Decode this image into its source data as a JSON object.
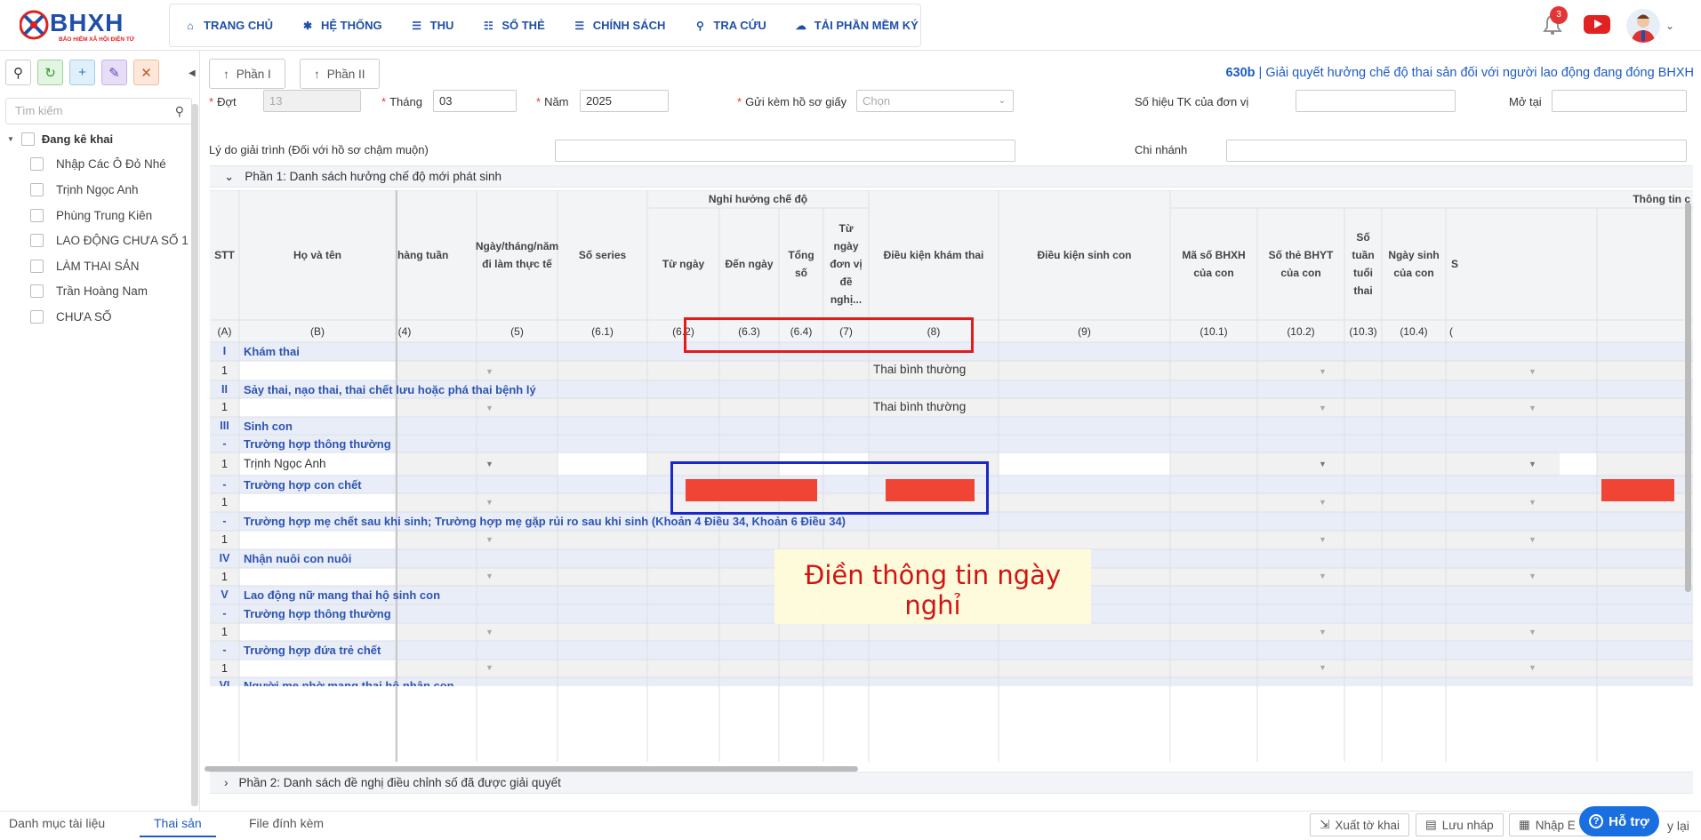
{
  "brand": {
    "name": "BHXH",
    "tagline": "BẢO HIỂM XÃ HỘI ĐIỆN TỬ"
  },
  "nav": [
    {
      "label": "TRANG CHỦ",
      "icon": "home-icon"
    },
    {
      "label": "HỆ THỐNG",
      "icon": "gear-icon"
    },
    {
      "label": "THU",
      "icon": "document-icon"
    },
    {
      "label": "SỔ THẺ",
      "icon": "card-icon"
    },
    {
      "label": "CHÍNH SÁCH",
      "icon": "policy-icon"
    },
    {
      "label": "TRA CỨU",
      "icon": "search-icon"
    },
    {
      "label": "TẢI PHẦN MỀM KÝ",
      "icon": "cloud-download-icon"
    }
  ],
  "header": {
    "notification_count": "3"
  },
  "sidebar": {
    "search_placeholder": "Tìm kiếm",
    "root_label": "Đang kê khai",
    "items": [
      "Nhập Các Ô Đỏ Nhé",
      "Trịnh Ngọc Anh",
      "Phùng Trung Kiên",
      "LAO ĐỘNG CHƯA SỐ 1",
      "LÀM THAI SẢN",
      "Trần Hoàng Nam",
      "CHƯA SỐ"
    ]
  },
  "parts": {
    "part1_btn": "Phần I",
    "part2_btn": "Phần II"
  },
  "form": {
    "code": "630b",
    "title": "Giải quyết hưởng chế độ thai sản đối với người lao động đang đóng BHXH",
    "dot_label": "Đợt",
    "dot_value": "13",
    "thang_label": "Tháng",
    "thang_value": "03",
    "nam_label": "Năm",
    "nam_value": "2025",
    "gui_label": "Gửi kèm hồ sơ giấy",
    "gui_placeholder": "Chọn",
    "sohieu_label": "Số hiệu TK của đơn vị",
    "motai_label": "Mở tại",
    "lydo_label": "Lý do giải trình (Đối với hồ sơ chậm muộn)",
    "chinhanh_label": "Chi nhánh"
  },
  "sections": {
    "part1": "Phần 1: Danh sách hưởng chế độ mới phát sinh",
    "part2": "Phần 2: Danh sách đề nghị điều chỉnh số đã được giải quyết"
  },
  "table": {
    "headers": {
      "stt": "STT",
      "hoten": "Họ và tên",
      "hangtuan": "hàng tuần",
      "ngaylam": "Ngày/tháng/năm đi làm thực tế",
      "series": "Số series",
      "nghi_group": "Nghỉ hưởng chế độ",
      "tungay": "Từ ngày",
      "denngay": "Đến ngày",
      "tongso": "Tổng số",
      "tungaydv": "Từ ngày đơn vị đề nghị...",
      "dkkham": "Điều kiện khám thai",
      "dksinh": "Điều kiện sinh con",
      "thongtin_group": "Thông tin c",
      "maso": "Mã số BHXH của con",
      "sothe": "Số thẻ BHYT của con",
      "sotuan": "Số tuần tuổi thai",
      "ngaysinh": "Ngày sinh của con",
      "s": "S"
    },
    "codes": [
      "(A)",
      "(B)",
      "(4)",
      "(5)",
      "(6.1)",
      "(6.2)",
      "(6.3)",
      "(6.4)",
      "(7)",
      "(8)",
      "(9)",
      "(10.1)",
      "(10.2)",
      "(10.3)",
      "(10.4)",
      "("
    ],
    "groups": [
      {
        "num": "I",
        "label": "Khám thai"
      },
      {
        "num": "II",
        "label": "Sảy thai, nạo thai, thai chết lưu hoặc phá thai bệnh lý"
      },
      {
        "num": "III",
        "label": "Sinh con"
      },
      {
        "num": "-",
        "label": "Trường hợp thông thường"
      },
      {
        "num": "-",
        "label": "Trường hợp con chết"
      },
      {
        "num": "-",
        "label": "Trường hợp mẹ chết sau khi sinh; Trường hợp mẹ gặp rủi ro sau khi sinh (Khoản 4 Điều 34, Khoản 6 Điều 34)"
      },
      {
        "num": "IV",
        "label": "Nhận nuôi con nuôi"
      },
      {
        "num": "V",
        "label": "Lao động nữ mang thai hộ sinh con"
      },
      {
        "num": "-",
        "label": "Trường hợp thông thường"
      },
      {
        "num": "-",
        "label": "Trường hợp đứa trẻ chết"
      },
      {
        "num": "VI",
        "label": "Người mẹ nhờ mang thai hộ nhận con"
      }
    ],
    "row_num": "1",
    "thai_binh_thuong": "Thai bình thường",
    "person": "Trịnh Ngọc Anh"
  },
  "annotation": {
    "text": "Điền thông tin ngày nghỉ"
  },
  "footer": {
    "tabs": [
      "Danh mục tài liệu",
      "Thai sản",
      "File đính kèm"
    ],
    "buttons": [
      "Xuất tờ khai",
      "Lưu nháp",
      "Nhập E"
    ],
    "help": "Hỗ trợ",
    "tail": "y lại"
  },
  "colors": {
    "brand": "#1f4fa8",
    "accent": "#1f5cc0",
    "required": "#e33333",
    "invalid_cell": "#f04435",
    "highlight_red": "#e21c1c",
    "highlight_blue": "#1a28c8"
  }
}
